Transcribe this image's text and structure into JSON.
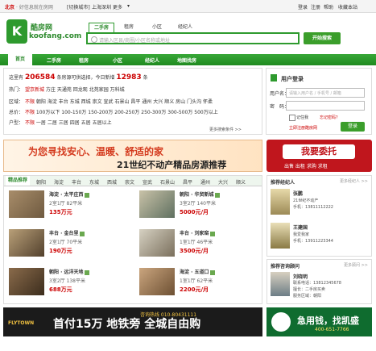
{
  "topbar": {
    "city": "北京",
    "tagline": "· 好信息就在房网",
    "switch_city": "[切换城市]",
    "cities": [
      "上海",
      "深圳"
    ],
    "more": "更多",
    "links": [
      "登录",
      "注册",
      "帮助",
      "收藏本站"
    ]
  },
  "logo": {
    "cn": "酷房网",
    "en": "koofang.com"
  },
  "search": {
    "tabs": [
      "二手房",
      "租房",
      "小区",
      "经纪人"
    ],
    "placeholder": "请输入区县/商圈/小区名称或地址",
    "button": "开始搜索"
  },
  "nav": {
    "items": [
      "首页",
      "二手房",
      "租房",
      "小区",
      "经纪人",
      "地图找房"
    ]
  },
  "stats": {
    "intro": "这里有",
    "listings_count": "206584",
    "mid": "条房源可供选择，今日新增",
    "new_count": "12983",
    "suffix": "条",
    "hot_label": "热门：",
    "hot_items": [
      "望京新城",
      "方庄",
      "天通苑",
      "回龙观",
      "北苑家园",
      "万科城"
    ],
    "district_label": "区域：",
    "districts": [
      "不限",
      "朝阳",
      "海淀",
      "丰台",
      "东城",
      "西城",
      "崇文",
      "宣武",
      "石景山",
      "昌平",
      "通州",
      "大兴",
      "顺义",
      "房山",
      "门头沟",
      "怀柔"
    ],
    "price_label": "总价：",
    "prices": [
      "不限",
      "100万以下",
      "100-150万",
      "150-200万",
      "200-250万",
      "250-300万",
      "300-500万",
      "500万以上"
    ],
    "room_label": "户型：",
    "rooms": [
      "不限",
      "一居",
      "二居",
      "三居",
      "四居",
      "五居",
      "五居以上"
    ],
    "more_link": "更多搜索条件 >>"
  },
  "login": {
    "title": "用户登录",
    "user_label": "用户名：",
    "user_placeholder": "请输入用户名 / 手机号 / 邮箱",
    "pass_label": "密　码：",
    "remember": "记住我",
    "forgot": "忘记密码？",
    "register": "立即注册酷房网",
    "submit": "登录"
  },
  "banner1": {
    "line1": "为您寻找安心、温暖、舒适的家",
    "line2": "21世纪不动产精品房源推荐"
  },
  "weituo": {
    "button": "我要委托",
    "sub": "出售  出租  求购  求租"
  },
  "listings": {
    "tabs": [
      "精品推荐",
      "朝阳",
      "海淀",
      "丰台",
      "东城",
      "西城",
      "崇文",
      "宣武",
      "石景山",
      "昌平",
      "通州",
      "大兴",
      "顺义"
    ],
    "items": [
      {
        "title": "海淀 · 太平庄西",
        "line": "2室1厅  82平米",
        "price": "135万元"
      },
      {
        "title": "朝阳 · 华贸新城",
        "line": "3室2厅  140平米",
        "price": "5000元/月"
      },
      {
        "title": "丰台 · 金台里",
        "line": "2室1厅  70平米",
        "price": "190万元"
      },
      {
        "title": "丰台 · 刘家窑",
        "line": "1室1厅  46平米",
        "price": "3500元/月"
      },
      {
        "title": "朝阳 · 远洋天地",
        "line": "3室2厅  138平米",
        "price": "688万元"
      },
      {
        "title": "海淀 · 五道口",
        "line": "1室1厅  62平米",
        "price": "2200元/月"
      }
    ]
  },
  "agents": {
    "title": "推荐经纪人",
    "more": "更多经纪人 >>",
    "items": [
      {
        "name": "张鹏",
        "line1": "21世纪不动产",
        "line2": "手机：13811112222"
      },
      {
        "name": "王建国",
        "line1": "我爱我家",
        "line2": "手机：13911223344"
      }
    ]
  },
  "consult": {
    "title": "推荐咨询顾问",
    "more": "更多顾问 >>",
    "name": "刘晓明",
    "line1": "联系电话：13812345678",
    "line2": "擅长：二手房买卖",
    "line3": "服务区域：朝阳"
  },
  "banner2": {
    "brand": "FLYTOWN",
    "main": "首付15万 地铁旁 全城自由购",
    "tel": "咨询热线 010-80431111"
  },
  "banner3": {
    "main": "急用钱，找凯盛",
    "tel": "400-651-7766"
  }
}
